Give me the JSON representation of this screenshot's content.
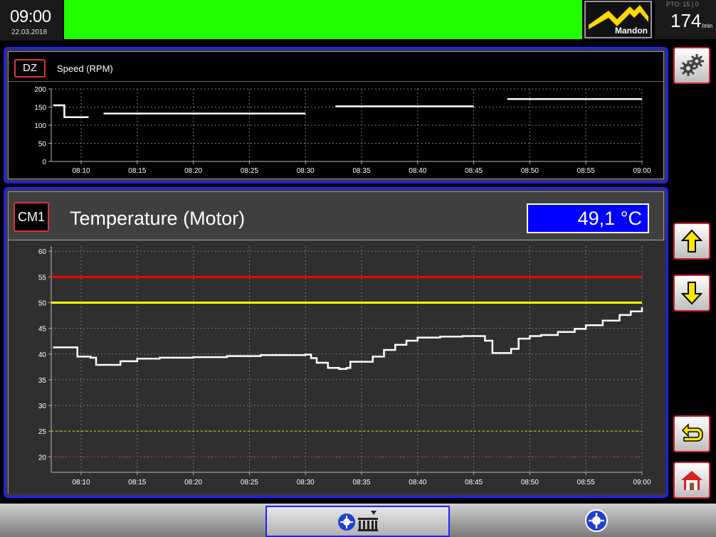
{
  "header": {
    "time": "09:00",
    "date": "22.03.2018",
    "logo_text": "Mandon",
    "pto_label": "PTO: 15 | 0",
    "speed_value": "174",
    "speed_unit": "/min",
    "banner_color": "#22ff00"
  },
  "speed_panel": {
    "tag": "DZ",
    "title": "Speed (RPM)"
  },
  "temp_panel": {
    "tag": "CM1",
    "title": "Temperature (Motor)",
    "current_value": "49,1 °C"
  },
  "side_buttons": {
    "settings_icon": "gears-icon",
    "up_icon": "arrow-up-icon",
    "down_icon": "arrow-down-icon",
    "back_icon": "return-arrow-icon",
    "home_icon": "home-icon"
  },
  "bottom_tabs": {
    "overview_icon": "machine-overview-icon",
    "gear_icon": "gear-circle-icon"
  },
  "chart_data": [
    {
      "type": "line",
      "title": "Speed (RPM)",
      "x_ticks": [
        "08:10",
        "08:15",
        "08:20",
        "08:25",
        "08:30",
        "08:35",
        "08:40",
        "08:45",
        "08:50",
        "08:55",
        "09:00"
      ],
      "y_ticks": [
        "0",
        "50",
        "100",
        "150",
        "200"
      ],
      "ylim": [
        0,
        200
      ],
      "xlim": [
        "08:07:20",
        "09:00"
      ],
      "grid": true,
      "series": [
        {
          "segments": [
            [
              [
                "08:07:30",
                155
              ],
              [
                "08:08:20",
                155
              ],
              [
                "08:08:30",
                122
              ],
              [
                "08:10:40",
                122
              ]
            ],
            [
              [
                "08:12:00",
                132
              ],
              [
                "08:30:00",
                132
              ]
            ],
            [
              [
                "08:32:40",
                152
              ],
              [
                "08:45:00",
                152
              ]
            ],
            [
              [
                "08:48:00",
                172
              ],
              [
                "09:00:00",
                172
              ]
            ]
          ],
          "color": "#ffffff"
        }
      ]
    },
    {
      "type": "line",
      "title": "Temperature (Motor)",
      "x_ticks": [
        "08:10",
        "08:15",
        "08:20",
        "08:25",
        "08:30",
        "08:35",
        "08:40",
        "08:45",
        "08:50",
        "08:55",
        "09:00"
      ],
      "y_ticks": [
        "20",
        "25",
        "30",
        "35",
        "40",
        "45",
        "50",
        "55",
        "60"
      ],
      "ylim": [
        17,
        61
      ],
      "xlim": [
        "08:07:20",
        "09:00"
      ],
      "grid": true,
      "thresholds": [
        {
          "value": 55,
          "color": "#ff0000",
          "style": "solid"
        },
        {
          "value": 50,
          "color": "#ffff00",
          "style": "solid"
        },
        {
          "value": 25,
          "color": "#e0e000",
          "style": "dashed"
        },
        {
          "value": 20,
          "color": "#e00000",
          "style": "dashed"
        }
      ],
      "series": [
        {
          "color": "#ffffff",
          "points": [
            [
              "08:07:30",
              41.3
            ],
            [
              "08:09:20",
              41.3
            ],
            [
              "08:09:40",
              39.5
            ],
            [
              "08:10:50",
              39.3
            ],
            [
              "08:11:20",
              37.9
            ],
            [
              "08:12:00",
              37.9
            ],
            [
              "08:13:30",
              38.6
            ],
            [
              "08:15:00",
              39.1
            ],
            [
              "08:17:00",
              39.3
            ],
            [
              "08:20:00",
              39.4
            ],
            [
              "08:23:00",
              39.6
            ],
            [
              "08:26:00",
              39.8
            ],
            [
              "08:30:00",
              39.9
            ],
            [
              "08:30:30",
              39.2
            ],
            [
              "08:31:00",
              38.3
            ],
            [
              "08:32:00",
              37.3
            ],
            [
              "08:33:00",
              37.1
            ],
            [
              "08:33:40",
              37.3
            ],
            [
              "08:34:00",
              38.5
            ],
            [
              "08:35:00",
              38.5
            ],
            [
              "08:36:00",
              39.5
            ],
            [
              "08:37:00",
              40.8
            ],
            [
              "08:38:00",
              41.8
            ],
            [
              "08:39:00",
              42.6
            ],
            [
              "08:40:00",
              43.2
            ],
            [
              "08:42:00",
              43.4
            ],
            [
              "08:44:00",
              43.5
            ],
            [
              "08:45:30",
              43.5
            ],
            [
              "08:46:00",
              42.6
            ],
            [
              "08:46:40",
              40.2
            ],
            [
              "08:47:40",
              40.2
            ],
            [
              "08:48:20",
              41.0
            ],
            [
              "08:49:00",
              43.0
            ],
            [
              "08:50:00",
              43.5
            ],
            [
              "08:51:00",
              43.7
            ],
            [
              "08:52:30",
              44.3
            ],
            [
              "08:54:00",
              44.9
            ],
            [
              "08:55:00",
              45.6
            ],
            [
              "08:56:30",
              46.5
            ],
            [
              "08:58:00",
              47.6
            ],
            [
              "08:59:00",
              48.3
            ],
            [
              "09:00:00",
              49.1
            ]
          ]
        }
      ]
    }
  ]
}
